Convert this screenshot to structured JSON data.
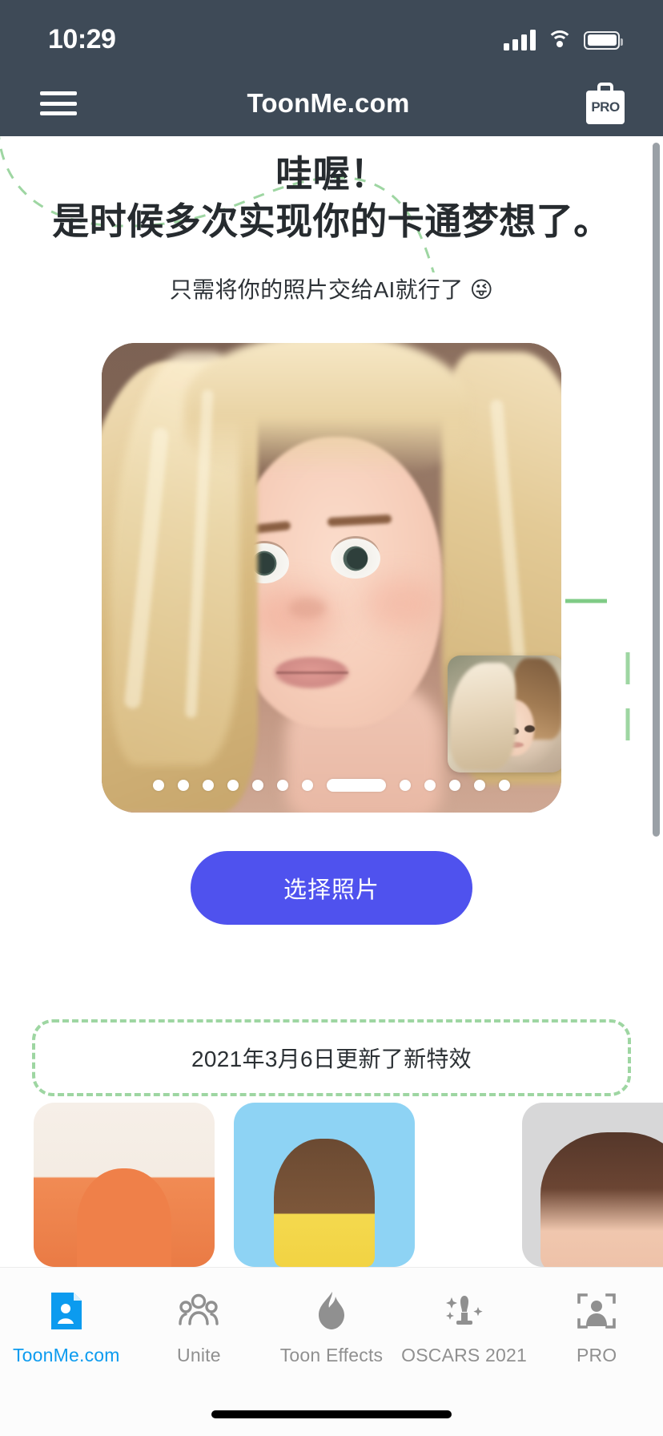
{
  "status_bar": {
    "time": "10:29",
    "signal_icon": "cellular-signal-icon",
    "wifi_icon": "wifi-icon",
    "battery_icon": "battery-icon"
  },
  "app_bar": {
    "menu_icon": "hamburger-menu-icon",
    "title": "ToonMe.com",
    "pro_label": "PRO",
    "pro_icon": "pro-briefcase-icon",
    "background_color": "#3E4A57"
  },
  "hero_section": {
    "headline_line1": "哇喔！",
    "headline_line2": "是时候多次实现你的卡通梦想了。",
    "subtitle": "只需将你的照片交给AI就行了 😜",
    "decoration_color": "#9ED6A2"
  },
  "carousel": {
    "preview_alt": "cartoon-portrait-preview",
    "pip_alt": "original-photo-thumbnail",
    "dots_before_active": 7,
    "dots_after_active": 5,
    "active_index": 7
  },
  "cta": {
    "label": "选择照片",
    "color": "#4F52EE"
  },
  "update_banner": {
    "text": "2021年3月6日更新了新特效",
    "border_color": "#9ED6A2"
  },
  "thumb_strip": [
    {
      "name": "thumbnail-orange-shirt"
    },
    {
      "name": "thumbnail-blue-background"
    },
    {
      "name": "thumbnail-gray-background"
    }
  ],
  "tab_bar": {
    "active_color": "#0C9BEF",
    "inactive_color": "#909090",
    "items": [
      {
        "label": "ToonMe.com",
        "icon": "toonme-document-icon",
        "active": true
      },
      {
        "label": "Unite",
        "icon": "people-group-icon",
        "active": false
      },
      {
        "label": "Toon Effects",
        "icon": "flame-icon",
        "active": false
      },
      {
        "label": "OSCARS 2021",
        "icon": "trophy-sparkle-icon",
        "active": false
      },
      {
        "label": "PRO",
        "icon": "portrait-frame-icon",
        "active": false
      }
    ]
  }
}
